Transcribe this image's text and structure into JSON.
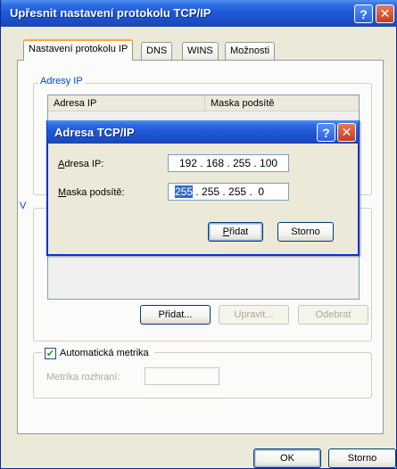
{
  "window": {
    "title": "Upřesnit nastavení protokolu TCP/IP",
    "help_glyph": "?",
    "close_glyph": "✕"
  },
  "tabs": [
    {
      "label": "Nastavení protokolu IP",
      "active": true
    },
    {
      "label": "DNS",
      "active": false
    },
    {
      "label": "WINS",
      "active": false
    },
    {
      "label": "Možnosti",
      "active": false
    }
  ],
  "ip_group": {
    "legend": "Adresy IP",
    "columns": [
      "Adresa IP",
      "Maska podsítě"
    ]
  },
  "gateway_group": {
    "legend_fragment": "V",
    "buttons": {
      "add": "Přidat...",
      "edit": "Upravit...",
      "remove": "Odebrat"
    }
  },
  "metric": {
    "checkbox_label": "Automatická metrika",
    "checked": true,
    "check_glyph": "✔",
    "field_label": "Metrika rozhraní:",
    "value": ""
  },
  "footer": {
    "ok": "OK",
    "cancel": "Storno"
  },
  "dialog": {
    "title": "Adresa TCP/IP",
    "help_glyph": "?",
    "close_glyph": "✕",
    "ip_label_hotkey": "A",
    "ip_label_rest": "dresa IP:",
    "ip_value": "192 . 168 . 255 . 100",
    "mask_label_hotkey": "M",
    "mask_label_rest": "aska podsítě:",
    "mask_selected": "255",
    "mask_rest": " . 255 . 255 .  0",
    "add_hotkey": "P",
    "add_rest": "řidat",
    "cancel": "Storno"
  },
  "colors": {
    "titlebar_blue": "#1f58d8",
    "close_red": "#c63b1e",
    "tab_highlight": "#f7a93b",
    "group_legend": "#0046d5",
    "selection": "#316ac5"
  }
}
